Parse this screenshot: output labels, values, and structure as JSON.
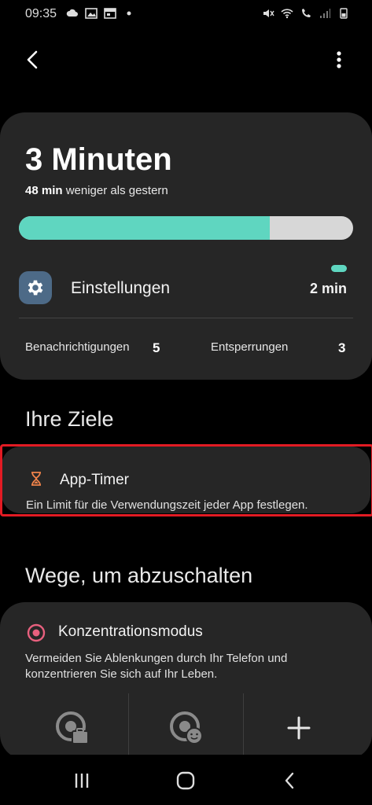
{
  "status": {
    "time": "09:35",
    "left_icons": [
      "cloud-icon",
      "image-icon",
      "calendar-icon",
      "dot-icon"
    ],
    "right_icons": [
      "mute-icon",
      "wifi-icon",
      "wifi-call-icon",
      "signal-icon",
      "battery-icon"
    ]
  },
  "topbar": {
    "back_icon": "back-arrow-icon",
    "more_icon": "more-vertical-icon"
  },
  "summary": {
    "total_time": "3 Minuten",
    "compare_value": "48 min",
    "compare_text": "weniger als gestern",
    "progress_fraction": 0.75,
    "colors": {
      "progress": "#5fd6c0",
      "track": "#d7d7d7"
    },
    "top_app": {
      "name": "Einstellungen",
      "time": "2 min",
      "icon": "gear-icon"
    },
    "notifications_label": "Benachrichtigungen",
    "notifications_value": "5",
    "unlocks_label": "Entsperrungen",
    "unlocks_value": "3"
  },
  "goals": {
    "title": "Ihre Ziele",
    "app_timer": {
      "title": "App-Timer",
      "description": "Ein Limit für die Verwendungszeit jeder App festlegen.",
      "icon": "hourglass-icon"
    }
  },
  "unwind": {
    "title": "Wege, um abzuschalten",
    "focus": {
      "title": "Konzentrationsmodus",
      "description": "Vermeiden Sie Ablenkungen durch Ihr Telefon und konzentrieren Sie sich auf Ihr Leben.",
      "icon": "target-icon",
      "modes": [
        "work-mode-icon",
        "me-time-mode-icon",
        "add-icon"
      ]
    }
  },
  "navbar": [
    "recent-apps-icon",
    "home-icon",
    "back-icon"
  ],
  "accent_colors": {
    "highlight": "#e21b23",
    "card": "#262626",
    "timer_icon": "#f0834a",
    "focus_icon": "#e8607e"
  }
}
